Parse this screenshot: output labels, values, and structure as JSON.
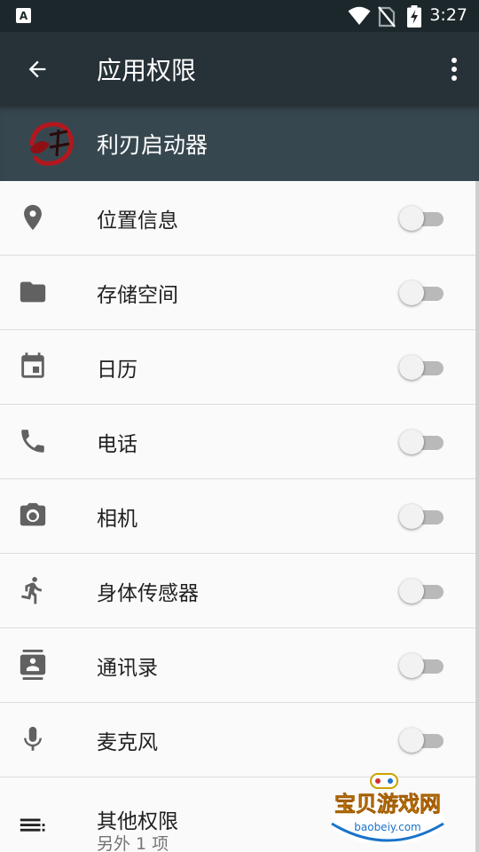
{
  "status_bar": {
    "notification_icon_text": "A",
    "time": "3:27",
    "icons": [
      "wifi-icon",
      "no-sim-icon",
      "battery-charging-icon"
    ]
  },
  "app_bar": {
    "title": "应用权限",
    "back_icon": "arrow-back-icon",
    "menu_icon": "more-vert-icon"
  },
  "app_header": {
    "app_name": "利刃启动器",
    "logo_text": "利刃"
  },
  "permissions": [
    {
      "label": "位置信息",
      "icon": "location-icon",
      "enabled": false
    },
    {
      "label": "存储空间",
      "icon": "folder-icon",
      "enabled": false
    },
    {
      "label": "日历",
      "icon": "calendar-icon",
      "enabled": false
    },
    {
      "label": "电话",
      "icon": "phone-icon",
      "enabled": false
    },
    {
      "label": "相机",
      "icon": "camera-icon",
      "enabled": false
    },
    {
      "label": "身体传感器",
      "icon": "running-person-icon",
      "enabled": false
    },
    {
      "label": "通讯录",
      "icon": "contacts-icon",
      "enabled": false
    },
    {
      "label": "麦克风",
      "icon": "microphone-icon",
      "enabled": false
    }
  ],
  "other_permissions": {
    "label": "其他权限",
    "sub": "另外 1 项",
    "icon": "list-icon"
  },
  "watermark": {
    "text": "宝贝游戏网",
    "url": "baobeiy.com"
  },
  "colors": {
    "status_bar": "#1c272c",
    "app_bar": "#273238",
    "app_header": "#37474f",
    "background": "#fafafa",
    "icon": "#616161"
  }
}
